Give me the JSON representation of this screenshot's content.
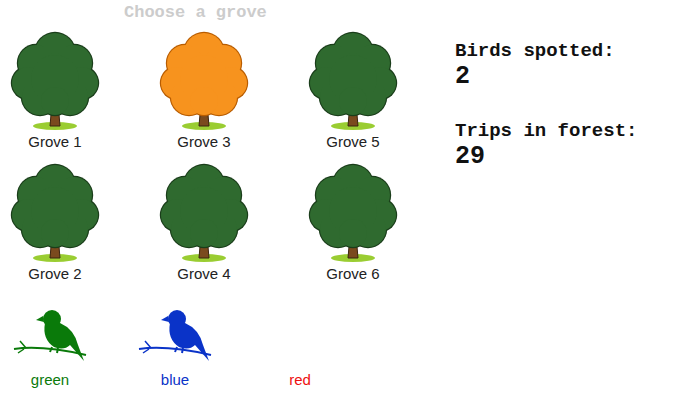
{
  "title": "Choose a grove",
  "groves": [
    {
      "label": "Grove 1",
      "selected": false
    },
    {
      "label": "Grove 2",
      "selected": false
    },
    {
      "label": "Grove 3",
      "selected": true
    },
    {
      "label": "Grove 4",
      "selected": false
    },
    {
      "label": "Grove 5",
      "selected": false
    },
    {
      "label": "Grove 6",
      "selected": false
    }
  ],
  "birds": [
    {
      "name": "green",
      "spotted": true,
      "color": "#0a7a0a"
    },
    {
      "name": "blue",
      "spotted": true,
      "color": "#0a33c8"
    },
    {
      "name": "red",
      "spotted": false,
      "color": "#ee1111"
    }
  ],
  "stats": [
    {
      "label": "Birds spotted:",
      "value": "2"
    },
    {
      "label": "Trips in forest:",
      "value": "29"
    }
  ]
}
